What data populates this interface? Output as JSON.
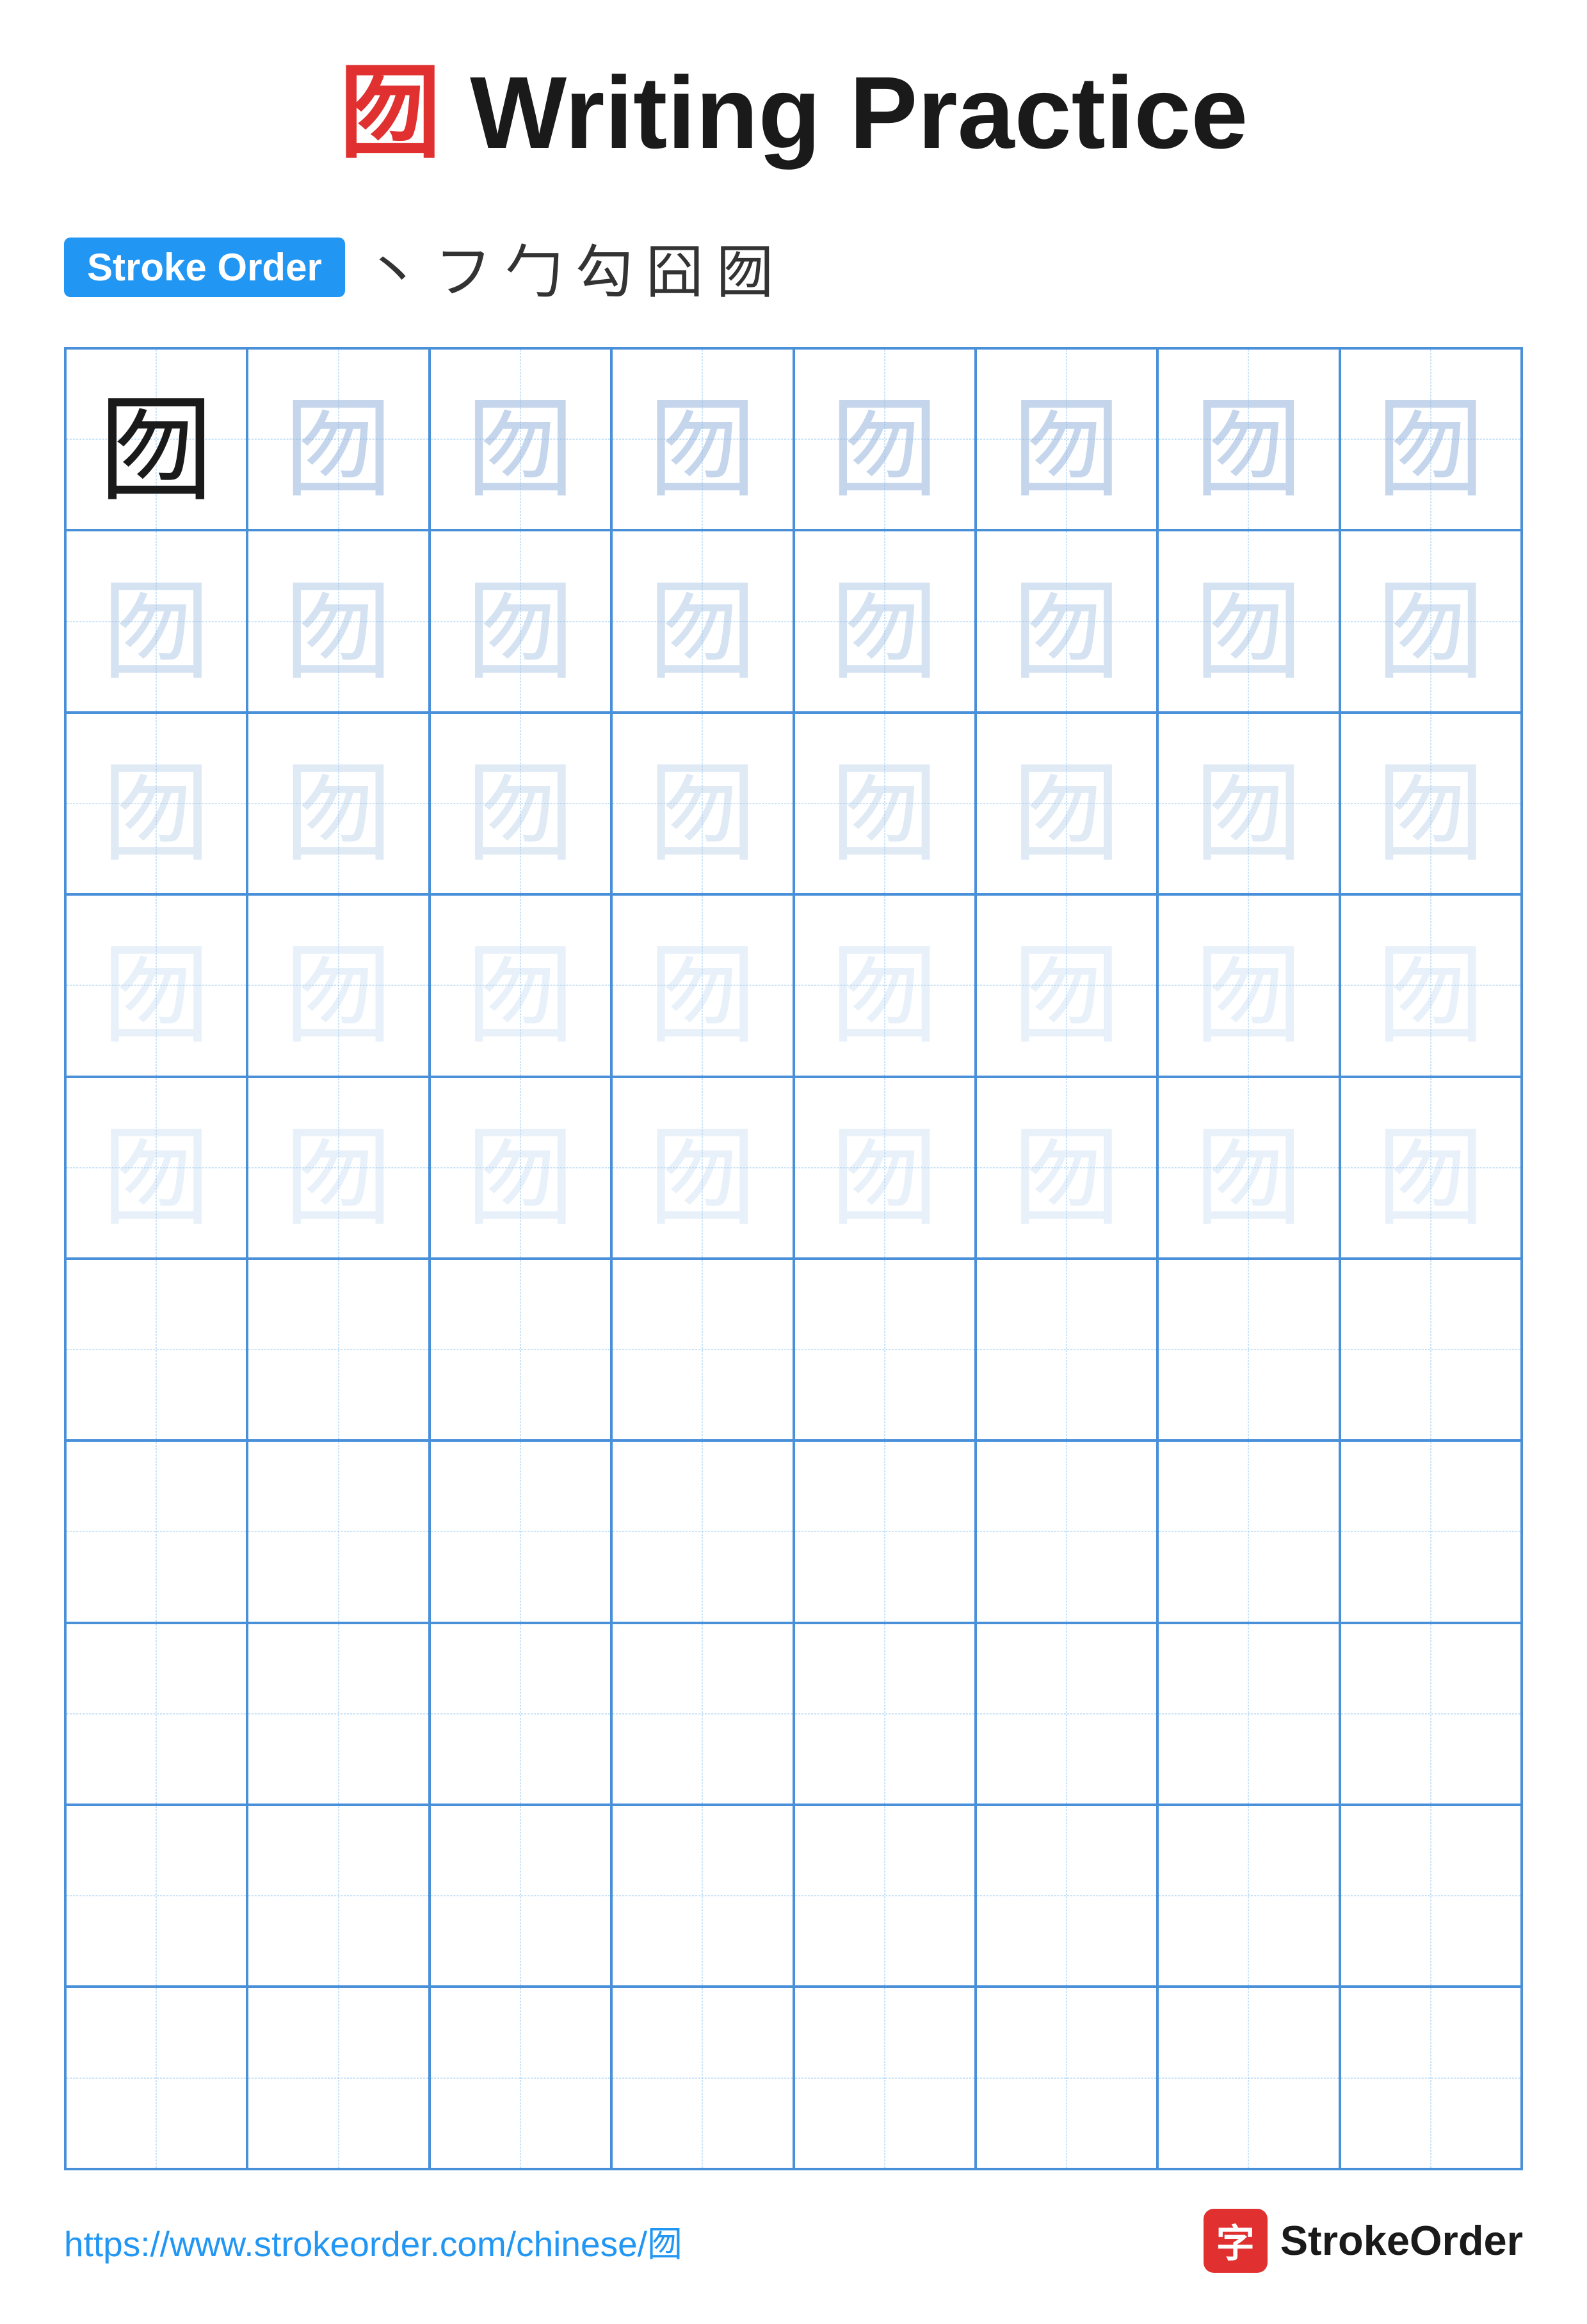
{
  "title": {
    "char": "囫",
    "text": " Writing Practice"
  },
  "stroke_order": {
    "badge_label": "Stroke Order",
    "strokes": [
      "丶",
      "フ",
      "勹",
      "勾",
      "囧",
      "囫"
    ]
  },
  "grid": {
    "rows": 10,
    "cols": 8,
    "character": "囫",
    "filled_rows": 5,
    "empty_rows": 5
  },
  "footer": {
    "url": "https://www.strokeorder.com/chinese/囫",
    "logo_char": "字",
    "logo_text": "StrokeOrder"
  }
}
